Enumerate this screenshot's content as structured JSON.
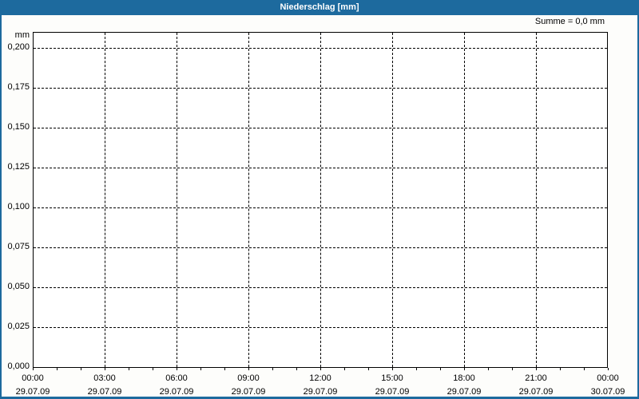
{
  "window": {
    "title": "Niederschlag [mm]"
  },
  "annotations": {
    "sum_label": "Summe = 0,0 mm"
  },
  "colors": {
    "frame_blue": "#1d6a9e",
    "title_text": "#ffffff",
    "background": "#fdfdfb",
    "plot_background": "#ffffff",
    "grid": "#000000",
    "text": "#000000"
  },
  "chart_data": {
    "type": "line",
    "title": "Niederschlag [mm]",
    "ylabel": "mm",
    "xlabel": "",
    "ylim": [
      0,
      0.21
    ],
    "grid": "dashed",
    "legend": "none",
    "sum_mm": 0.0,
    "y_axis": {
      "unit": "mm",
      "tick_labels": [
        "0,200",
        "0,175",
        "0,150",
        "0,125",
        "0,100",
        "0,075",
        "0,050",
        "0,025",
        "0,000"
      ],
      "tick_values": [
        0.2,
        0.175,
        0.15,
        0.125,
        0.1,
        0.075,
        0.05,
        0.025,
        0.0
      ]
    },
    "x_axis": {
      "span_hours": 24,
      "major_step_hours": 3,
      "minor_step_hours": 1,
      "major_ticks": [
        {
          "hour": 0,
          "time": "00:00",
          "date": "29.07.09"
        },
        {
          "hour": 3,
          "time": "03:00",
          "date": "29.07.09"
        },
        {
          "hour": 6,
          "time": "06:00",
          "date": "29.07.09"
        },
        {
          "hour": 9,
          "time": "09:00",
          "date": "29.07.09"
        },
        {
          "hour": 12,
          "time": "12:00",
          "date": "29.07.09"
        },
        {
          "hour": 15,
          "time": "15:00",
          "date": "29.07.09"
        },
        {
          "hour": 18,
          "time": "18:00",
          "date": "29.07.09"
        },
        {
          "hour": 21,
          "time": "21:00",
          "date": "29.07.09"
        },
        {
          "hour": 24,
          "time": "00:00",
          "date": "30.07.09"
        }
      ]
    },
    "series": [
      {
        "name": "Niederschlag",
        "values": []
      }
    ]
  }
}
